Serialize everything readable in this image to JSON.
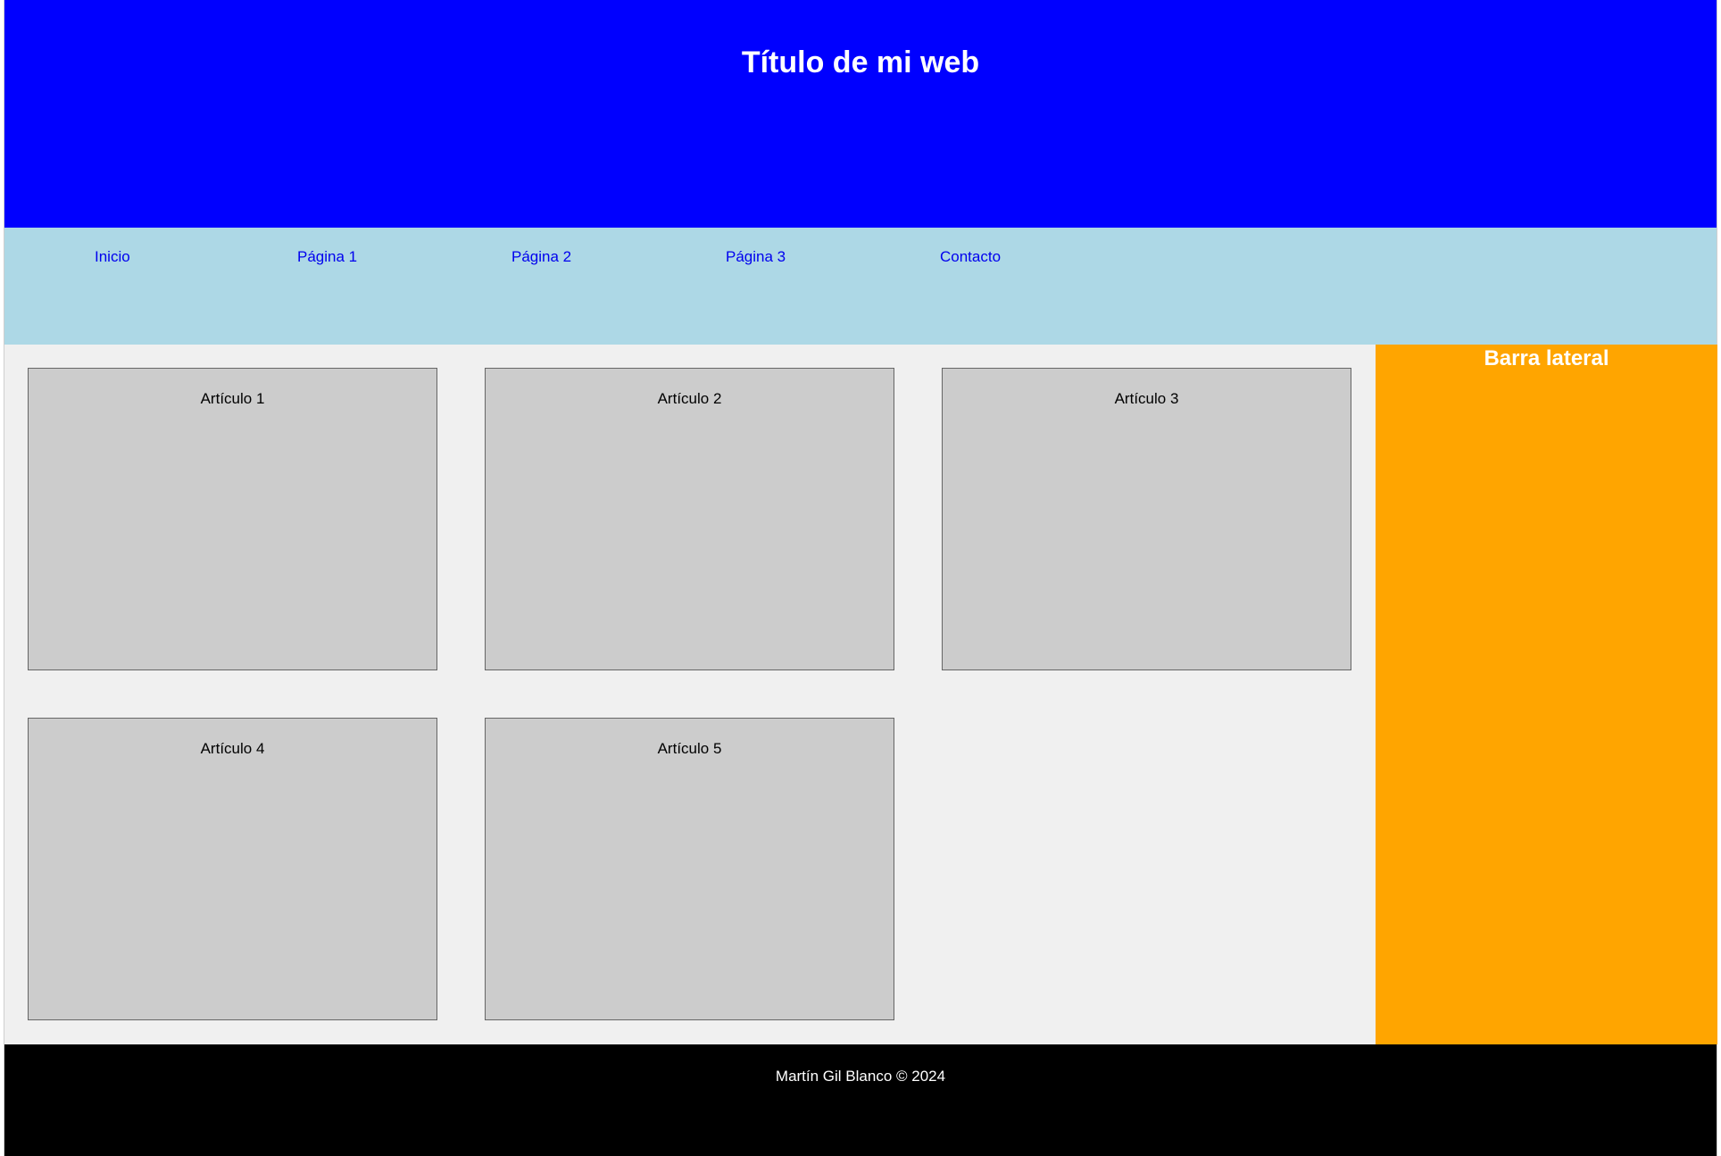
{
  "header": {
    "title": "Título de mi web"
  },
  "nav": {
    "items": [
      {
        "label": "Inicio"
      },
      {
        "label": "Página 1"
      },
      {
        "label": "Página 2"
      },
      {
        "label": "Página 3"
      },
      {
        "label": "Contacto"
      }
    ]
  },
  "main": {
    "articles": [
      {
        "label": "Artículo 1"
      },
      {
        "label": "Artículo 2"
      },
      {
        "label": "Artículo 3"
      },
      {
        "label": "Artículo 4"
      },
      {
        "label": "Artículo 5"
      }
    ]
  },
  "sidebar": {
    "title": "Barra lateral"
  },
  "footer": {
    "text": "Martín Gil Blanco © 2024"
  },
  "colors": {
    "header_bg": "#0000ff",
    "nav_bg": "#add8e6",
    "main_bg": "#f0f0f0",
    "article_bg": "#cccccc",
    "sidebar_bg": "#ffa500",
    "footer_bg": "#000000",
    "link": "#0000ee"
  }
}
